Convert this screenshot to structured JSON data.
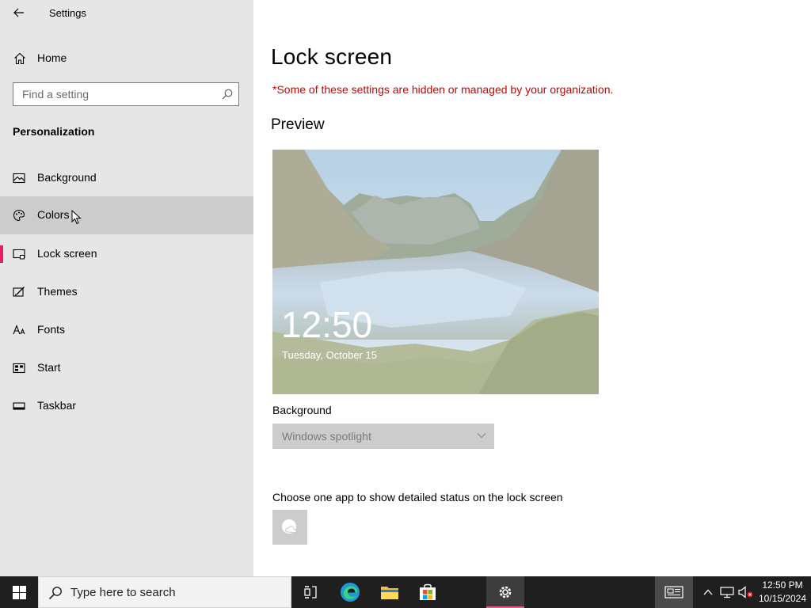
{
  "window": {
    "title": "Settings"
  },
  "sidebar": {
    "home_label": "Home",
    "search_placeholder": "Find a setting",
    "section_title": "Personalization",
    "items": [
      {
        "label": "Background",
        "icon": "picture-icon"
      },
      {
        "label": "Colors",
        "icon": "palette-icon"
      },
      {
        "label": "Lock screen",
        "icon": "lock-screen-icon"
      },
      {
        "label": "Themes",
        "icon": "themes-icon"
      },
      {
        "label": "Fonts",
        "icon": "fonts-icon"
      },
      {
        "label": "Start",
        "icon": "start-icon"
      },
      {
        "label": "Taskbar",
        "icon": "taskbar-icon"
      }
    ],
    "hovered_item": "Colors",
    "selected_item": "Lock screen",
    "selected_accent": "#e81e63"
  },
  "main": {
    "title": "Lock screen",
    "warning": "*Some of these settings are hidden or managed by your organization.",
    "warning_color": "#c50500",
    "preview_heading": "Preview",
    "preview_time": "12:50",
    "preview_date": "Tuesday, October 15",
    "background_label": "Background",
    "background_value": "Windows spotlight",
    "detailed_status_label": "Choose one app to show detailed status on the lock screen"
  },
  "taskbar": {
    "search_text": "Type here to search",
    "clock_time": "12:50 PM",
    "clock_date": "10/15/2024"
  }
}
